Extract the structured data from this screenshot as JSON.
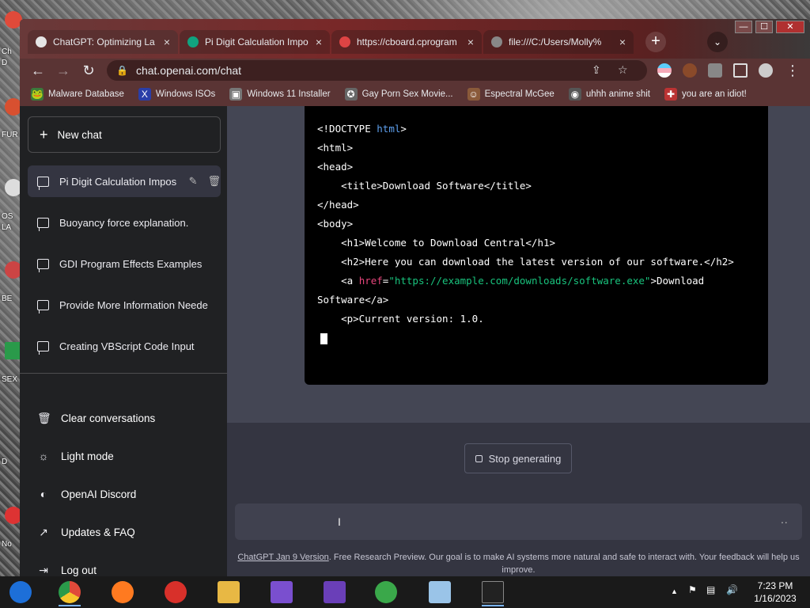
{
  "desktop": {
    "labels": [
      "Ch",
      "D",
      "FUR",
      "OS",
      "LA",
      "BE",
      "SEX",
      "D",
      "No"
    ]
  },
  "tabs": [
    {
      "title": "ChatGPT: Optimizing La",
      "close": "×",
      "color": "#e5e5e5"
    },
    {
      "title": "Pi Digit Calculation Impo",
      "close": "×",
      "color": "#10a37f"
    },
    {
      "title": "https://cboard.cprogram",
      "close": "×",
      "color": "#d44"
    },
    {
      "title": "file:///C:/Users/Molly%",
      "close": "×",
      "color": "#888"
    }
  ],
  "browser": {
    "new_tab": "+",
    "tab_search": "⌄",
    "win_min": "—",
    "win_max": "☐",
    "win_close": "✕",
    "back": "←",
    "forward": "→",
    "reload": "↻",
    "lock": "🔒",
    "url": "chat.openai.com/chat",
    "share": "⇪",
    "star": "☆",
    "menu": "⋮"
  },
  "bookmarks": [
    {
      "label": "Malware Database",
      "icon": "🐸",
      "color": "#3b7a3b"
    },
    {
      "label": "Windows ISOs",
      "icon": "X",
      "color": "#2a3ea8"
    },
    {
      "label": "Windows 11 Installer",
      "icon": "▣",
      "color": "#777"
    },
    {
      "label": "Gay Porn Sex Movie...",
      "icon": "✪",
      "color": "#666"
    },
    {
      "label": "Espectral McGee",
      "icon": "☺",
      "color": "#8a5a3a"
    },
    {
      "label": "uhhh anime shit",
      "icon": "◉",
      "color": "#555"
    },
    {
      "label": "you are an idiot!",
      "icon": "✚",
      "color": "#b33"
    }
  ],
  "sidebar": {
    "new_chat": "New chat",
    "conversations": [
      {
        "title": "Pi Digit Calculation Impos",
        "active": true
      },
      {
        "title": "Buoyancy force explanation.",
        "active": false
      },
      {
        "title": "GDI Program Effects Examples",
        "active": false
      },
      {
        "title": "Provide More Information Neede",
        "active": false
      },
      {
        "title": "Creating VBScript Code Input",
        "active": false
      }
    ],
    "menu": [
      {
        "label": "Clear conversations",
        "icon": "🗑"
      },
      {
        "label": "Light mode",
        "icon": "☼"
      },
      {
        "label": "OpenAI Discord",
        "icon": "◐"
      },
      {
        "label": "Updates & FAQ",
        "icon": "↗"
      },
      {
        "label": "Log out",
        "icon": "⇥"
      }
    ]
  },
  "code": {
    "lines": [
      [
        {
          "t": "<!DOCTYPE ",
          "c": ""
        },
        {
          "t": "html",
          "c": "kw"
        },
        {
          "t": ">",
          "c": ""
        }
      ],
      [
        {
          "t": "<html>",
          "c": ""
        }
      ],
      [
        {
          "t": "<head>",
          "c": ""
        }
      ],
      [
        {
          "t": "    <title>Download Software</title>",
          "c": ""
        }
      ],
      [
        {
          "t": "</head>",
          "c": ""
        }
      ],
      [
        {
          "t": "<body>",
          "c": ""
        }
      ],
      [
        {
          "t": "    <h1>Welcome to Download Central</h1>",
          "c": ""
        }
      ],
      [
        {
          "t": "    <h2>Here you can download the latest version of our software.</h2>",
          "c": ""
        }
      ],
      [
        {
          "t": "    <a ",
          "c": ""
        },
        {
          "t": "href",
          "c": "attr"
        },
        {
          "t": "=",
          "c": ""
        },
        {
          "t": "\"https://example.com/downloads/software.exe\"",
          "c": "str"
        },
        {
          "t": ">Download",
          "c": ""
        }
      ],
      [
        {
          "t": "Software</a>",
          "c": ""
        }
      ],
      [
        {
          "t": "    <p>Current version: 1.0.",
          "c": ""
        }
      ]
    ]
  },
  "main": {
    "stop_label": "Stop generating",
    "input_dots": "··",
    "ibeam": "I",
    "footer_link": "ChatGPT Jan 9 Version",
    "footer_text": ". Free Research Preview. Our goal is to make AI systems more natural and safe to interact with. Your feedback will help us improve."
  },
  "taskbar": {
    "apps": [
      {
        "name": "windows-media-center",
        "color": "#1d6fd8",
        "active": false
      },
      {
        "name": "chrome",
        "color": "#e04a3a",
        "active": true
      },
      {
        "name": "firefox",
        "color": "#ff7a20",
        "active": false
      },
      {
        "name": "opera",
        "color": "#d8302a",
        "active": false
      },
      {
        "name": "file-explorer",
        "color": "#e8b844",
        "active": false
      },
      {
        "name": "visual-studio-installer",
        "color": "#7a4fcf",
        "active": false
      },
      {
        "name": "visual-studio",
        "color": "#6a3fb8",
        "active": false
      },
      {
        "name": "messenger",
        "color": "#3aa84a",
        "active": false
      },
      {
        "name": "notepad",
        "color": "#9ac4e8",
        "active": false
      },
      {
        "name": "command-prompt",
        "color": "#222",
        "active": true
      }
    ],
    "tray_up": "▲",
    "time": "7:23 PM",
    "date": "1/16/2023"
  }
}
